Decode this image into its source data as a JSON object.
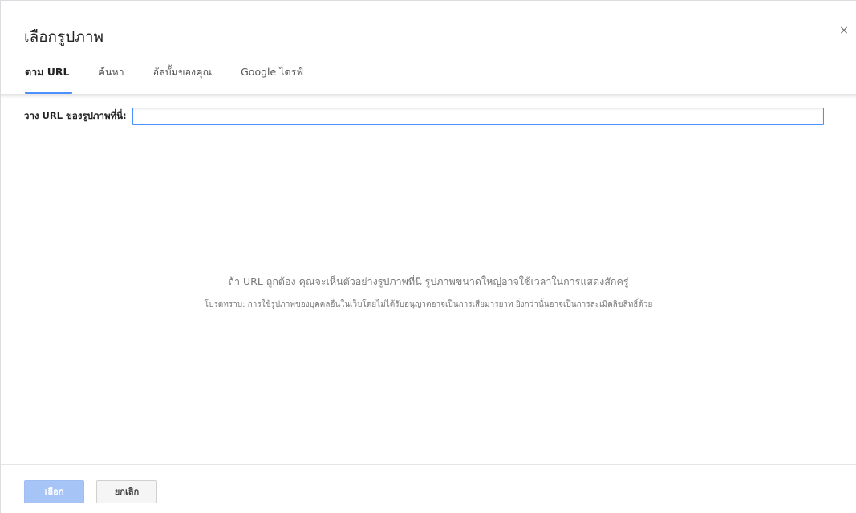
{
  "dialog": {
    "title": "เลือกรูปภาพ",
    "close_symbol": "×"
  },
  "tabs": [
    {
      "label": "ตาม URL",
      "active": true
    },
    {
      "label": "ค้นหา",
      "active": false
    },
    {
      "label": "อัลบั้มของคุณ",
      "active": false
    },
    {
      "label": "Google ไดรฟ์",
      "active": false
    }
  ],
  "url_field": {
    "label": "วาง URL ของรูปภาพที่นี่:",
    "value": "",
    "placeholder": ""
  },
  "preview": {
    "message": "ถ้า URL ถูกต้อง คุณจะเห็นตัวอย่างรูปภาพที่นี่ รูปภาพขนาดใหญ่อาจใช้เวลาในการแสดงสักครู่",
    "note": "โปรดทราบ: การใช้รูปภาพของบุคคลอื่นในเว็บโดยไม่ได้รับอนุญาตอาจเป็นการเสียมารยาท ยิ่งกว่านั้นอาจเป็นการละเมิดลิขสิทธิ์ด้วย"
  },
  "footer": {
    "select_label": "เลือก",
    "cancel_label": "ยกเลิก"
  },
  "colors": {
    "accent": "#4d90fe",
    "primary_button_disabled": "#a7c4f7"
  }
}
